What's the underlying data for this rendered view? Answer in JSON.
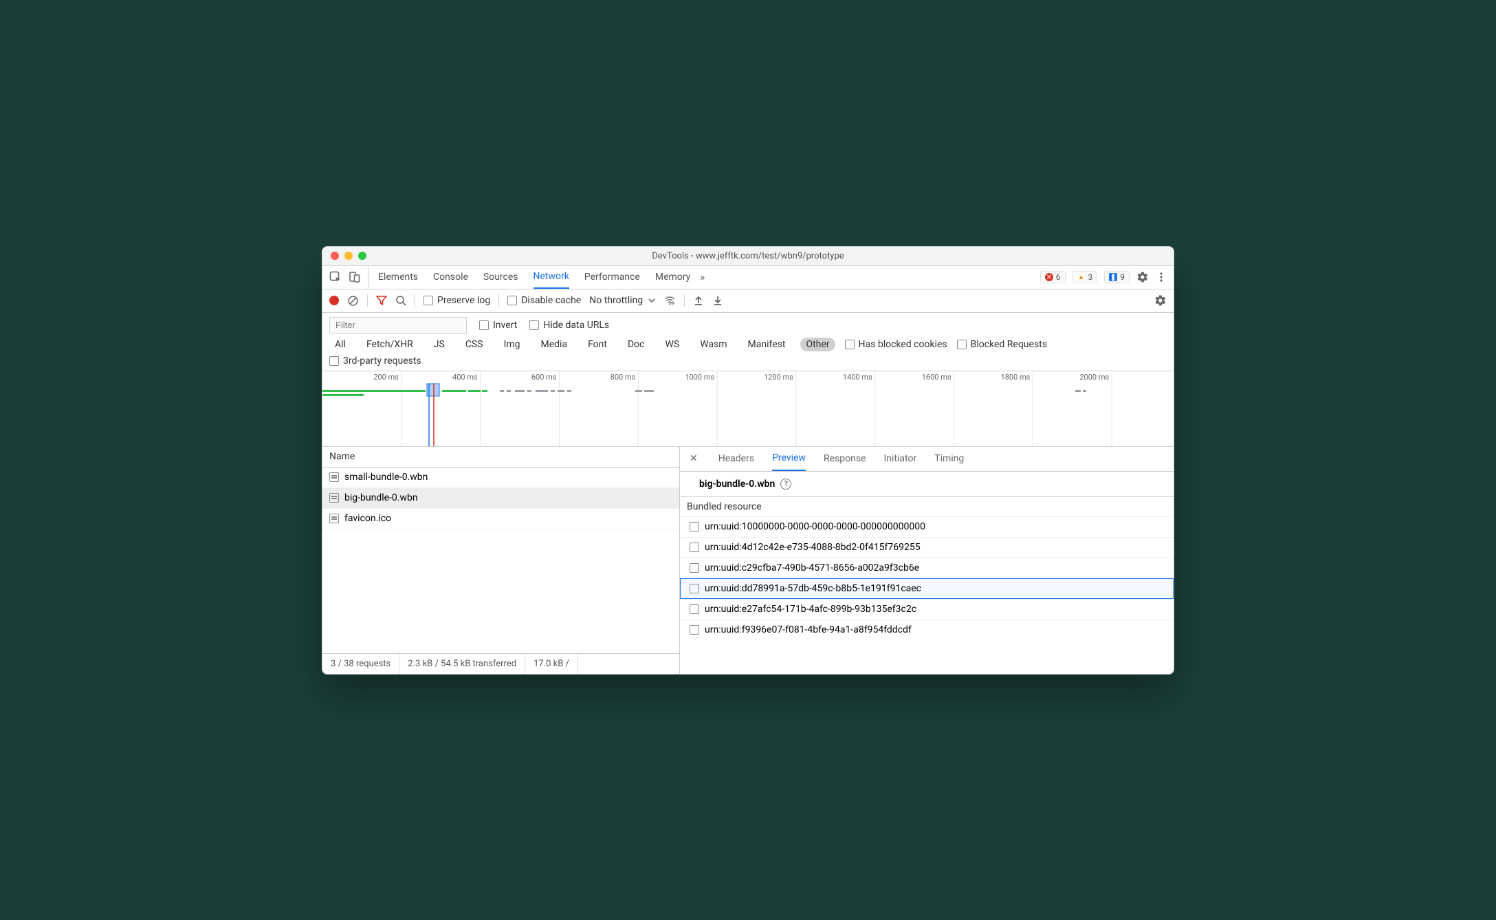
{
  "window": {
    "title": "DevTools - www.jefftk.com/test/wbn9/prototype"
  },
  "main_tabs": {
    "items": [
      "Elements",
      "Console",
      "Sources",
      "Network",
      "Performance",
      "Memory"
    ],
    "active": "Network",
    "overflow_glyph": "»"
  },
  "badges": {
    "errors": "6",
    "warnings": "3",
    "messages": "9"
  },
  "toolbar": {
    "preserve_log": "Preserve log",
    "disable_cache": "Disable cache",
    "throttling": "No throttling"
  },
  "filter": {
    "placeholder": "Filter",
    "invert": "Invert",
    "hide_data_urls": "Hide data URLs",
    "types": [
      "All",
      "Fetch/XHR",
      "JS",
      "CSS",
      "Img",
      "Media",
      "Font",
      "Doc",
      "WS",
      "Wasm",
      "Manifest",
      "Other"
    ],
    "active_type": "Other",
    "has_blocked_cookies": "Has blocked cookies",
    "blocked_requests": "Blocked Requests",
    "third_party": "3rd-party requests"
  },
  "timeline": {
    "ticks": [
      "200 ms",
      "400 ms",
      "600 ms",
      "800 ms",
      "1000 ms",
      "1200 ms",
      "1400 ms",
      "1600 ms",
      "1800 ms",
      "2000 ms"
    ]
  },
  "requests": {
    "header": "Name",
    "rows": [
      {
        "name": "small-bundle-0.wbn",
        "selected": false
      },
      {
        "name": "big-bundle-0.wbn",
        "selected": true
      },
      {
        "name": "favicon.ico",
        "selected": false
      }
    ]
  },
  "status": {
    "count": "3 / 38 requests",
    "transferred": "2.3 kB / 54.5 kB transferred",
    "size": "17.0 kB /"
  },
  "detail": {
    "tabs": [
      "Headers",
      "Preview",
      "Response",
      "Initiator",
      "Timing"
    ],
    "active": "Preview",
    "filename": "big-bundle-0.wbn",
    "section": "Bundled resource",
    "resources": [
      "urn:uuid:10000000-0000-0000-0000-000000000000",
      "urn:uuid:4d12c42e-e735-4088-8bd2-0f415f769255",
      "urn:uuid:c29cfba7-490b-4571-8656-a002a9f3cb6e",
      "urn:uuid:dd78991a-57db-459c-b8b5-1e191f91caec",
      "urn:uuid:e27afc54-171b-4afc-899b-93b135ef3c2c",
      "urn:uuid:f9396e07-f081-4bfe-94a1-a8f954fddcdf"
    ],
    "highlight_index": 3
  }
}
